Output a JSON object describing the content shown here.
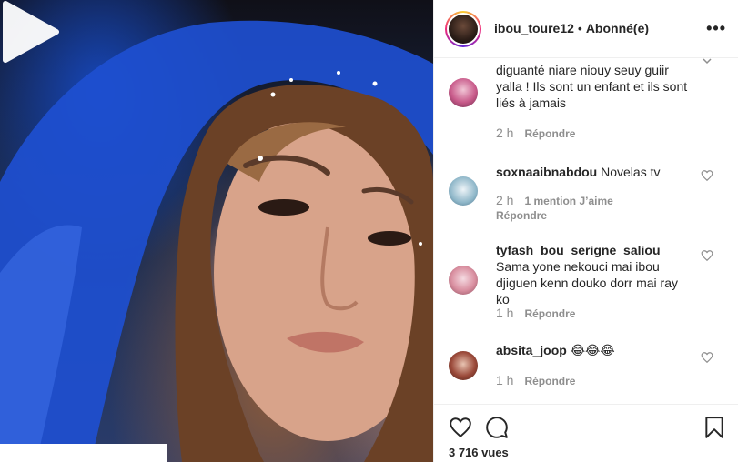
{
  "header": {
    "username": "ibou_toure12",
    "separator": "•",
    "follow_status": "Abonné(e)",
    "more_label": "•••"
  },
  "comments": [
    {
      "username": "",
      "text": "diguanté niare niouy seuy guiir yalla ! Ils sont un enfant et ils sont liés à jamais",
      "time": "2 h",
      "likes": "",
      "reply": "Répondre",
      "avatar_color": "#c85a8a"
    },
    {
      "username": "soxnaaibnabdou",
      "text": "Novelas tv",
      "time": "2 h",
      "likes": "1 mention J’aime",
      "reply": "Répondre",
      "avatar_color": "#8fb7c9"
    },
    {
      "username": "tyfash_bou_serigne_saliou",
      "text": "Sama yone nekouci mai ibou djiguen kenn douko dorr mai ray ko",
      "time": "1 h",
      "likes": "",
      "reply": "Répondre",
      "avatar_color": "#d98fa0"
    },
    {
      "username": "absita_joop",
      "text": "😂😂😂",
      "time": "1 h",
      "likes": "",
      "reply": "Répondre",
      "avatar_color": "#9b4a3a"
    }
  ],
  "footer": {
    "views": "3 716 vues"
  },
  "icons": {
    "play": "play-icon",
    "like": "heart-icon",
    "comment": "comment-icon",
    "save": "bookmark-icon",
    "more": "more-icon"
  }
}
